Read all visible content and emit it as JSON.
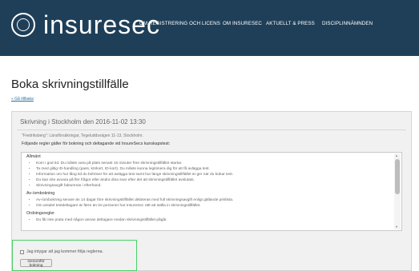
{
  "header": {
    "logo_text": "insuresec",
    "nav": [
      "OM REGISTRERING OCH LICENS",
      "OM INSURESEC",
      "AKTUELLT & PRESS",
      "DISCIPLINNÄMNDEN"
    ]
  },
  "page": {
    "title": "Boka skrivningstillfälle",
    "back_link": "« Gå tillbaka"
  },
  "panel": {
    "header": "Skrivning i Stockholm den 2016-11-02 13:30",
    "meta": "\"Fredriksberg\": Länsförsäkringar, Tegeluddsvägen 11-13, Stockholm.",
    "rules_intro": "Följande regler gäller för bokning och deltagande vid InsureSecs kunskapstest:",
    "sections": [
      {
        "title": "Allmänt",
        "items": [
          "Kom i god tid. Du måste vara på plats senast 15 minuter före skrivningstillfället startar.",
          "Ta med giltig ID-handling (pass, körkort, ID-kort). Du måste kunna legitimera dig för att få avlägga test.",
          "Information om hur lång tid du behöver för att avlägga test samt hur länge skrivningstillfället är ger när du bokar test.",
          "Du kan inte avvara på fler frågor eller ändra dina svar efter det att skrivningstillfället avslutats.",
          "Skrivningsavgift faktureras i efterhand."
        ]
      },
      {
        "title": "Av-/ombokning",
        "items": [
          "Av-/ombokning senare än 14 dagar före skrivningstillfället debiteras med full skrivningsavgift enligt gällande prislista.",
          "Om antalet testdeltagare är färre än tre personer har InsureSec rätt att ställa in skrivningstillfället."
        ]
      },
      {
        "title": "Ordningsregler",
        "items": [
          "Du får inte prata med någon annan deltagare medan skrivningstillfället pågår."
        ]
      }
    ],
    "agree_label": "Jag intygar att jag kommer följa reglerna.",
    "confirm_button": "Genomför bokning"
  },
  "colors": {
    "header_bg": "#1f3f58",
    "highlight": "#4cd06a",
    "link": "#2a6e9e"
  }
}
